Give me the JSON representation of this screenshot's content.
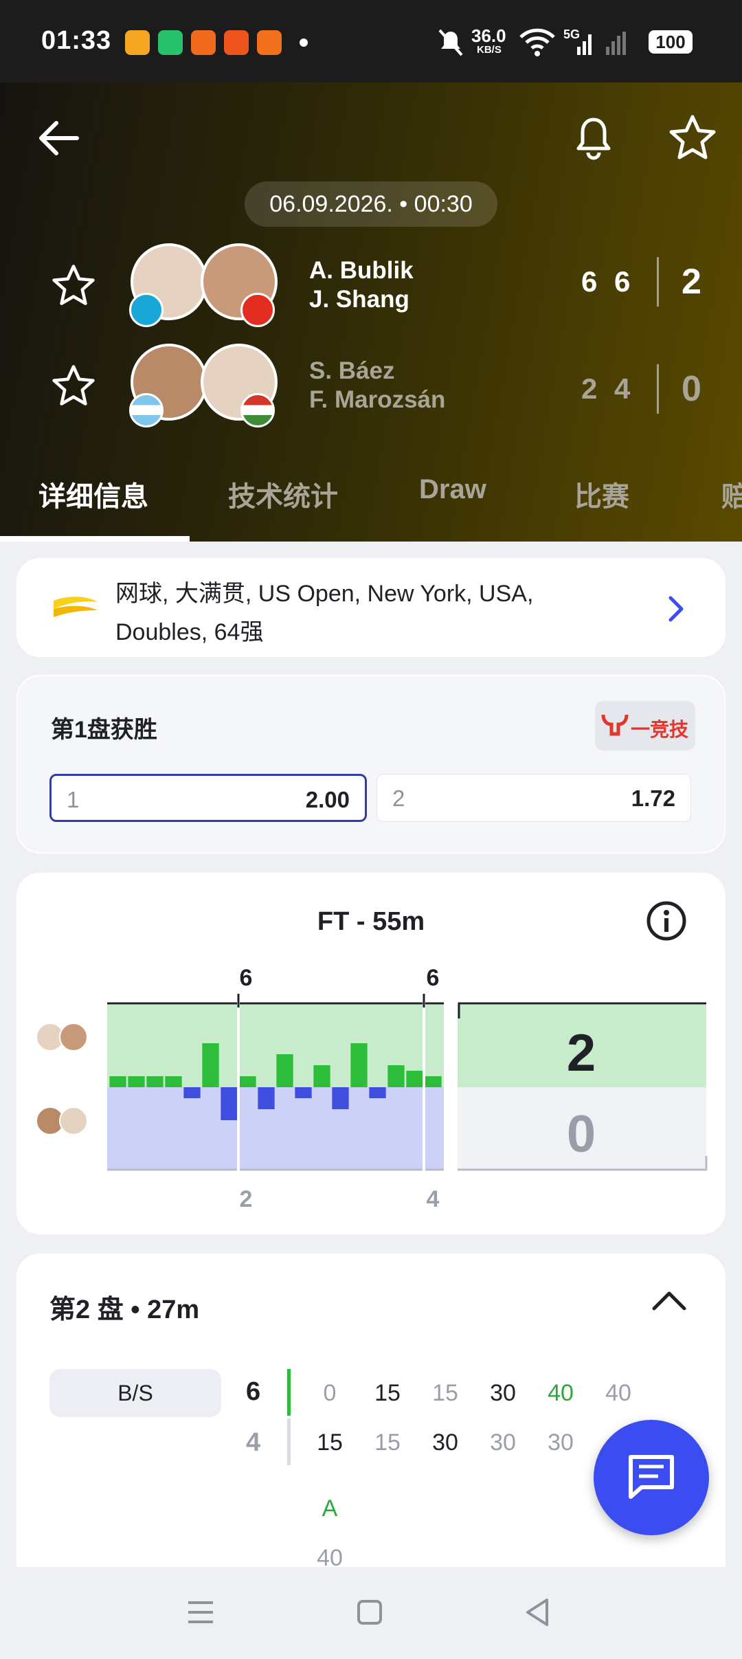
{
  "status_bar": {
    "time": "01:33",
    "net_speed_value": "36.0",
    "net_speed_unit": "KB/S",
    "network": "5G",
    "battery": "100"
  },
  "header": {
    "date": "06.09.2026. • 00:30",
    "team1": {
      "p1": "A. Bublik",
      "p2": "J. Shang",
      "sets": [
        "6",
        "6"
      ],
      "total": "2"
    },
    "team2": {
      "p1": "S. Báez",
      "p2": "F. Marozsán",
      "sets": [
        "2",
        "4"
      ],
      "total": "0"
    }
  },
  "tabs": [
    "详细信息",
    "技术统计",
    "Draw",
    "比赛",
    "赔"
  ],
  "tournament": {
    "line1": "网球, 大满贯, US Open, New York, USA,",
    "line2": "Doubles, 64强"
  },
  "odds": {
    "title": "第1盘获胜",
    "brand": "一竞技",
    "options": [
      {
        "key": "1",
        "value": "2.00"
      },
      {
        "key": "2",
        "value": "1.72"
      }
    ]
  },
  "momentum": {
    "title": "FT - 55m",
    "top_labels": [
      "6",
      "6"
    ],
    "bottom_labels": [
      "2",
      "4"
    ],
    "total_top": "2",
    "total_bottom": "0"
  },
  "chart_data": {
    "type": "bar",
    "series": [
      {
        "values": [
          1,
          1,
          1,
          1,
          -1,
          4,
          -3,
          1,
          -2,
          3,
          -1,
          2,
          -2,
          4,
          -1,
          2,
          1.5,
          1
        ]
      }
    ],
    "set_ends_after_point": [
      7,
      17
    ]
  },
  "set2": {
    "title": "第2 盘 • 27m",
    "bs_label": "B/S",
    "game_scores": [
      "6",
      "4"
    ],
    "row1": [
      "0",
      "15",
      "15",
      "30",
      "40",
      "40"
    ],
    "row2": [
      "15",
      "15",
      "30",
      "30",
      "30",
      ""
    ],
    "advantage": "A",
    "row3": "40"
  },
  "colors": {
    "accent_blue": "#3b4cf0",
    "green_bar": "#2ebd3a",
    "blue_bar": "#3e4fe0",
    "green_bg": "#c8eccb",
    "blue_bg": "#cdd0f7"
  }
}
